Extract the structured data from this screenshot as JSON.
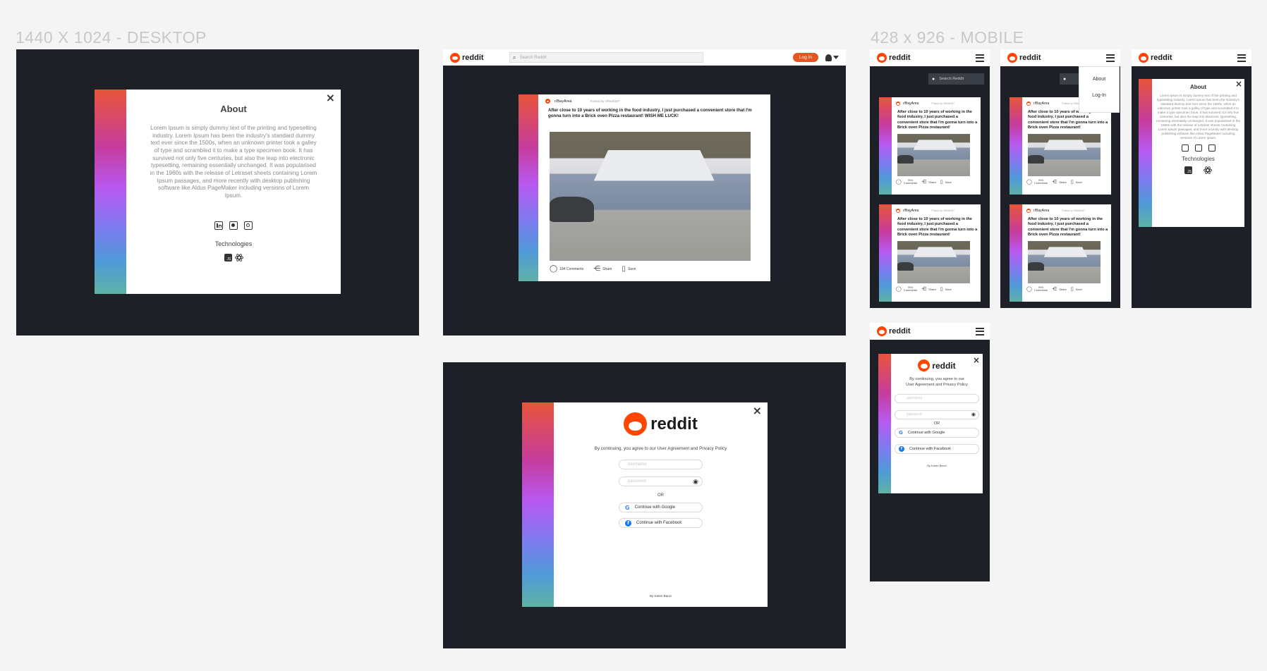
{
  "labels": {
    "desktop": "1440 X 1024 - DESKTOP",
    "mobile": "428 x 926 - MOBILE"
  },
  "colors": {
    "background": "#1d2127",
    "brand": "#ff4500",
    "canvas": "#f4f4f4"
  },
  "about": {
    "title": "About",
    "close": "×",
    "body": "Lorem Ipsum is simply dummy text of the printing and typesetting industry. Lorem Ipsum has been the industry's standard dummy text ever since the 1500s, when an unknown printer took a galley of type and scrambled it to make a type specimen book. It has survived not only five centuries, but also the leap into electronic typesetting, remaining essentially unchanged. It was popularised in the 1960s with the release of Letraset sheets containing Lorem Ipsum passages, and more recently with desktop publishing software like Aldus PageMaker including versions of Lorem Ipsum.",
    "socials": [
      "linkedin-icon",
      "github-icon",
      "instagram-icon"
    ],
    "tech_label": "Technologies",
    "tech": [
      "javascript-icon",
      "react-icon"
    ]
  },
  "header": {
    "logo": "reddit",
    "search_placeholder": "Search Reddit",
    "login": "Log In"
  },
  "post": {
    "subreddit": "r/BayArea",
    "posted_by": "Posted by r/Redit187",
    "title": "After close to 10 years of working in the food industry, I just purchased a convenient store that I'm gonna turn into a Brick oven Pizza restaurant! WISH ME LUCK!",
    "comments": "184 Comments",
    "share": "Share",
    "save": "Save"
  },
  "mobile_post": {
    "subreddit": "r/BayArea",
    "posted_by": "Posted by r/Redit187",
    "title": "After close to 10 years of working in the food industry, I just purchased a convenient store that I'm gonna turn into a Brick oven Pizza restaurant!",
    "comments_count": "994",
    "comments_word": "Comments",
    "share": "Share",
    "save": "Save"
  },
  "menu": {
    "about": "About",
    "login": "Log-In"
  },
  "login": {
    "logo": "reddit",
    "close": "×",
    "agreement": "By continuing, you agree to our User Agreement and Privacy Policy",
    "agreement_mobile_1": "By continuing, you agree to our",
    "agreement_mobile_2": "User Agreement and Privacy Policy",
    "username_placeholder": "username",
    "password_placeholder": "password",
    "or": "OR",
    "google": "Continue with Google",
    "facebook": "Continue with Facebook",
    "credit": "By Karen Banci"
  }
}
